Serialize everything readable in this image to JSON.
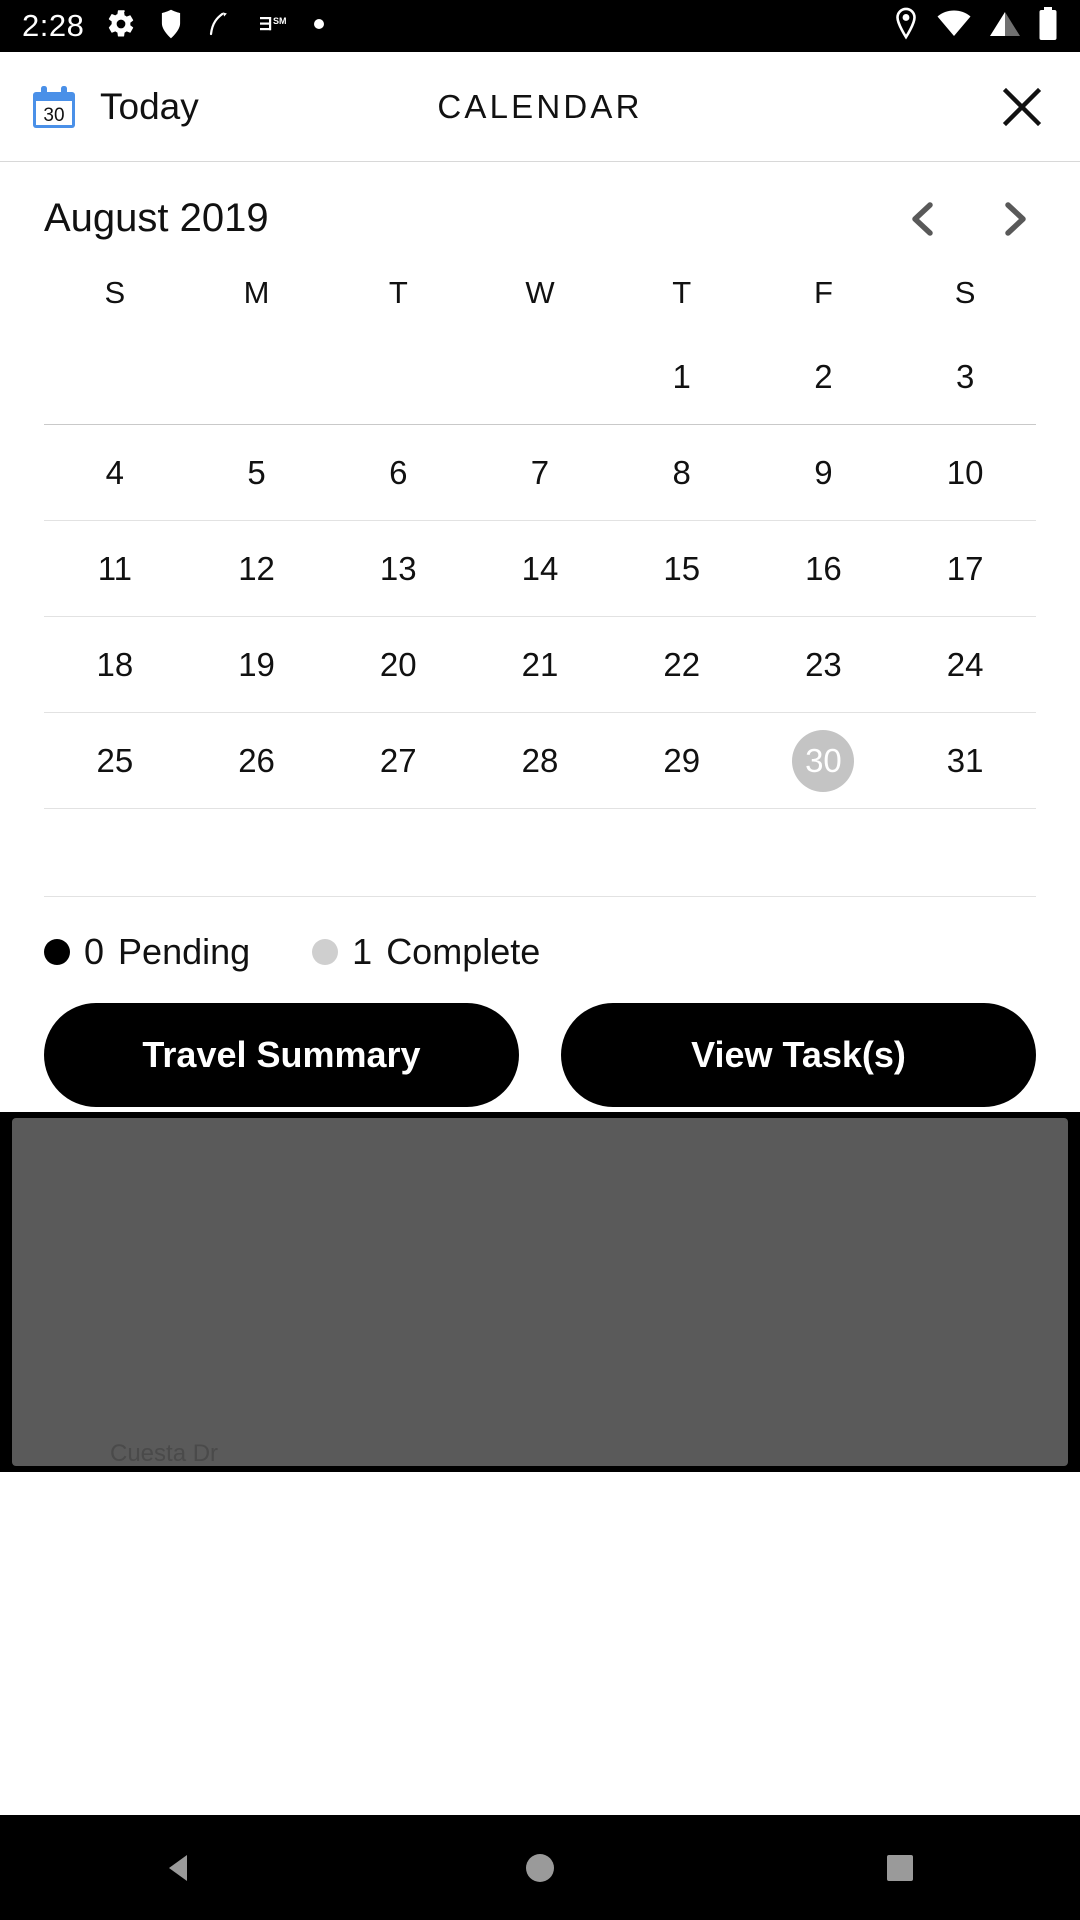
{
  "status_bar": {
    "time": "2:28",
    "left_icons": [
      "gear-icon",
      "shield-icon",
      "curve-graph-icon",
      "sim-icon",
      "dot-icon"
    ],
    "right_icons": [
      "location-pin-icon",
      "wifi-icon",
      "cell-signal-icon",
      "battery-icon"
    ]
  },
  "header": {
    "calendar_badge_day": "30",
    "today_label": "Today",
    "title": "CALENDAR",
    "close_label": "✕"
  },
  "month_nav": {
    "title": "August 2019",
    "prev_label": "‹",
    "next_label": "›"
  },
  "calendar": {
    "weekdays": [
      "S",
      "M",
      "T",
      "W",
      "T",
      "F",
      "S"
    ],
    "today": "30",
    "weeks": [
      [
        "",
        "",
        "",
        "",
        "1",
        "2",
        "3"
      ],
      [
        "4",
        "5",
        "6",
        "7",
        "8",
        "9",
        "10"
      ],
      [
        "11",
        "12",
        "13",
        "14",
        "15",
        "16",
        "17"
      ],
      [
        "18",
        "19",
        "20",
        "21",
        "22",
        "23",
        "24"
      ],
      [
        "25",
        "26",
        "27",
        "28",
        "29",
        "30",
        "31"
      ]
    ]
  },
  "legend": {
    "pending_count": "0",
    "pending_label": "Pending",
    "complete_count": "1",
    "complete_label": "Complete"
  },
  "actions": {
    "travel_summary": "Travel Summary",
    "view_tasks": "View Task(s)"
  },
  "backdrop": {
    "ghost_text": "Cuesta Dr"
  },
  "nav_bar": {
    "back": "back-triangle-icon",
    "home": "home-circle-icon",
    "recents": "recents-square-icon"
  },
  "colors": {
    "accent_blue": "#4a90e8",
    "today_circle": "#c4c4c4",
    "pending_dot": "#000000",
    "complete_dot": "#cfcfcf",
    "button_bg": "#000000",
    "chevron": "#595959"
  }
}
